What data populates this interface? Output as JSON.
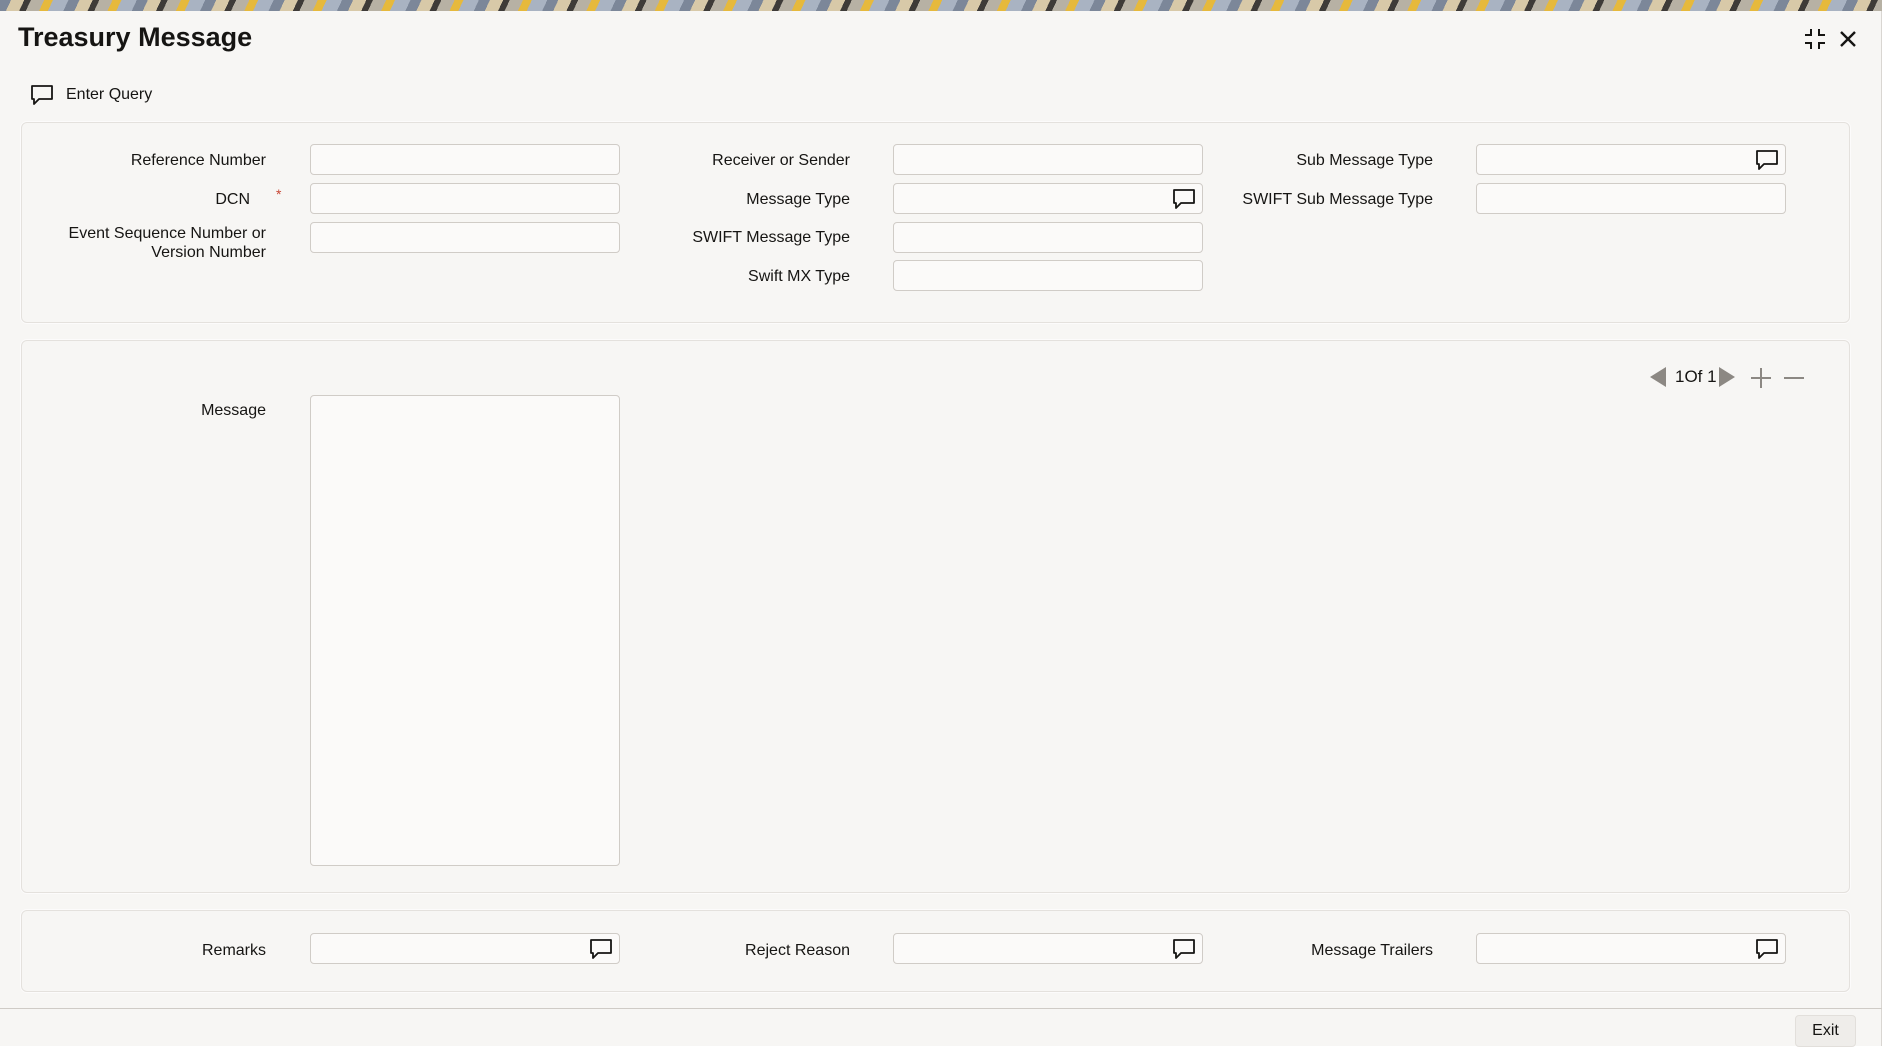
{
  "window": {
    "title": "Treasury Message",
    "controls": [
      "minimize-icon",
      "close-icon"
    ]
  },
  "toolbar": {
    "enter_query_label": "Enter Query",
    "enter_query_icon": "chat-bubble-icon"
  },
  "header_form": {
    "reference_number": {
      "label": "Reference Number",
      "value": ""
    },
    "dcn": {
      "label": "DCN",
      "value": "",
      "required_mark": "*"
    },
    "event_sequence": {
      "label_line1": "Event Sequence Number or",
      "label_line2": "Version Number",
      "value": ""
    },
    "receiver_or_sender": {
      "label": "Receiver or Sender",
      "value": ""
    },
    "message_type": {
      "label": "Message Type",
      "value": ""
    },
    "swift_message_type": {
      "label": "SWIFT Message Type",
      "value": ""
    },
    "swift_mx_type": {
      "label": "Swift MX Type",
      "value": ""
    },
    "sub_message_type": {
      "label": "Sub Message Type",
      "value": ""
    },
    "swift_sub_message_type": {
      "label": "SWIFT Sub Message Type",
      "value": ""
    }
  },
  "message_section": {
    "pager_text": "1Of 1",
    "message": {
      "label": "Message",
      "value": ""
    }
  },
  "footer_form": {
    "remarks": {
      "label": "Remarks",
      "value": ""
    },
    "reject_reason": {
      "label": "Reject Reason",
      "value": ""
    },
    "message_trailers": {
      "label": "Message Trailers",
      "value": ""
    }
  },
  "footer": {
    "exit_label": "Exit"
  },
  "colors": {
    "background": "#f7f6f4",
    "required": "#c74634",
    "text": "#161513",
    "border": "#d0ccc7"
  }
}
